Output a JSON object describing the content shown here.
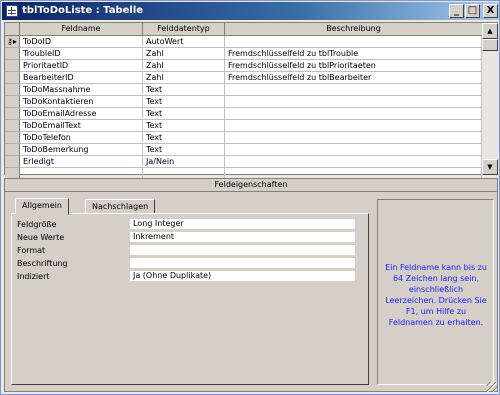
{
  "window": {
    "title": "tblToDoListe : Tabelle",
    "controls": {
      "minimize": "_",
      "maximize": "□",
      "close": "X"
    }
  },
  "grid": {
    "columns": [
      "Feldname",
      "Felddatentyp",
      "Beschreibung"
    ],
    "rows": [
      {
        "name": "ToDoID",
        "type": "AutoWert",
        "desc": "",
        "primary_key": true
      },
      {
        "name": "TroubleID",
        "type": "Zahl",
        "desc": "Fremdschlüsselfeld zu tblTrouble"
      },
      {
        "name": "PrioritaetID",
        "type": "Zahl",
        "desc": "Fremdschlüsselfeld zu tblPrioritaeten"
      },
      {
        "name": "BearbeiterID",
        "type": "Zahl",
        "desc": "Fremdschlüsselfeld zu tblBearbeiter"
      },
      {
        "name": "ToDoMassnahme",
        "type": "Text",
        "desc": ""
      },
      {
        "name": "ToDoKontaktieren",
        "type": "Text",
        "desc": ""
      },
      {
        "name": "ToDoEmailAdresse",
        "type": "Text",
        "desc": ""
      },
      {
        "name": "ToDoEmailText",
        "type": "Text",
        "desc": ""
      },
      {
        "name": "ToDoTelefon",
        "type": "Text",
        "desc": ""
      },
      {
        "name": "ToDoBemerkung",
        "type": "Text",
        "desc": ""
      },
      {
        "name": "Erledigt",
        "type": "Ja/Nein",
        "desc": ""
      },
      {
        "name": "",
        "type": "",
        "desc": ""
      }
    ],
    "key_icon": "key-selector-icon"
  },
  "properties": {
    "title": "Feldeigenschaften",
    "tabs": [
      "Allgemein",
      "Nachschlagen"
    ],
    "active_tab": "Allgemein",
    "fields": [
      {
        "label": "Feldgröße",
        "value": "Long Integer"
      },
      {
        "label": "Neue Werte",
        "value": "Inkrement"
      },
      {
        "label": "Format",
        "value": ""
      },
      {
        "label": "Beschriftung",
        "value": ""
      },
      {
        "label": "Indiziert",
        "value": "Ja (Ohne Duplikate)"
      }
    ],
    "help_text": "Ein Feldname kann bis zu 64 Zeichen lang sein, einschließlich Leerzeichen. Drücken Sie F1, um Hilfe zu Feldnamen zu erhalten."
  },
  "colors": {
    "title_gradient_start": "#0a246a",
    "help_text": "#1a1aff",
    "face": "#d4d0c8"
  }
}
